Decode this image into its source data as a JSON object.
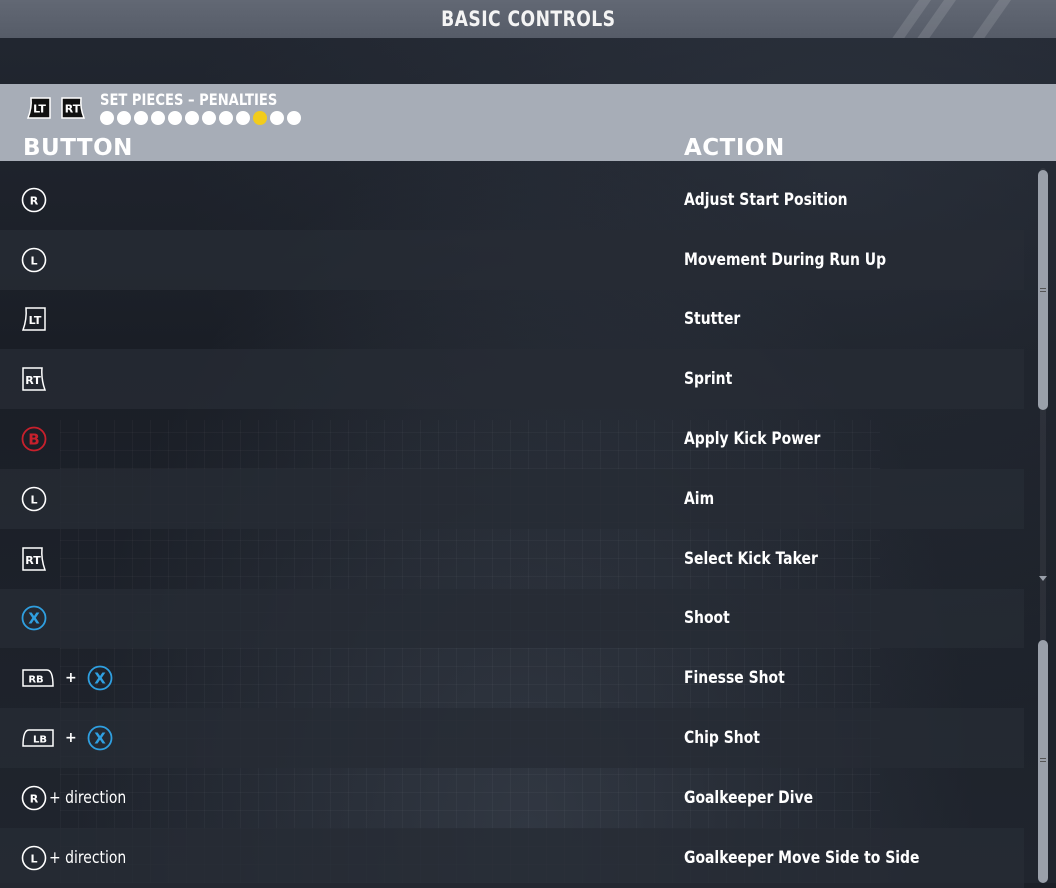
{
  "screen": {
    "title": "BASIC CONTROLS"
  },
  "section": {
    "left_tab_icon": "LT",
    "right_tab_icon": "RT",
    "label": "SET PIECES – PENALTIES",
    "page_total": 12,
    "page_index": 10,
    "accent_color": "#f2cc1c"
  },
  "columns": {
    "button": "BUTTON",
    "action": "ACTION"
  },
  "controls": [
    {
      "icons": [
        "R-stick"
      ],
      "extra": "",
      "action": "Adjust Start Position"
    },
    {
      "icons": [
        "L-stick"
      ],
      "extra": "",
      "action": "Movement During Run Up"
    },
    {
      "icons": [
        "LT"
      ],
      "extra": "",
      "action": "Stutter"
    },
    {
      "icons": [
        "RT"
      ],
      "extra": "",
      "action": "Sprint"
    },
    {
      "icons": [
        "B"
      ],
      "extra": "",
      "action": "Apply Kick Power"
    },
    {
      "icons": [
        "L-stick"
      ],
      "extra": "",
      "action": "Aim"
    },
    {
      "icons": [
        "RT"
      ],
      "extra": "",
      "action": "Select Kick Taker"
    },
    {
      "icons": [
        "X"
      ],
      "extra": "",
      "action": "Shoot"
    },
    {
      "icons": [
        "RB",
        "X"
      ],
      "extra": "",
      "action": "Finesse Shot"
    },
    {
      "icons": [
        "LB",
        "X"
      ],
      "extra": "",
      "action": "Chip Shot"
    },
    {
      "icons": [
        "R-stick"
      ],
      "extra": "+ direction",
      "action": "Goalkeeper Dive"
    },
    {
      "icons": [
        "L-stick"
      ],
      "extra": "+ direction",
      "action": "Goalkeeper Move Side to Side"
    }
  ],
  "icon_glyphs": {
    "R-stick": "R",
    "L-stick": "L",
    "LT": "LT",
    "RT": "RT",
    "B": "B",
    "X": "X",
    "RB": "RB",
    "LB": "LB",
    "plus": "+"
  },
  "colors": {
    "b_button": "#c8202c",
    "x_button": "#2f9fe0",
    "header_panel": "#a7adb7"
  }
}
